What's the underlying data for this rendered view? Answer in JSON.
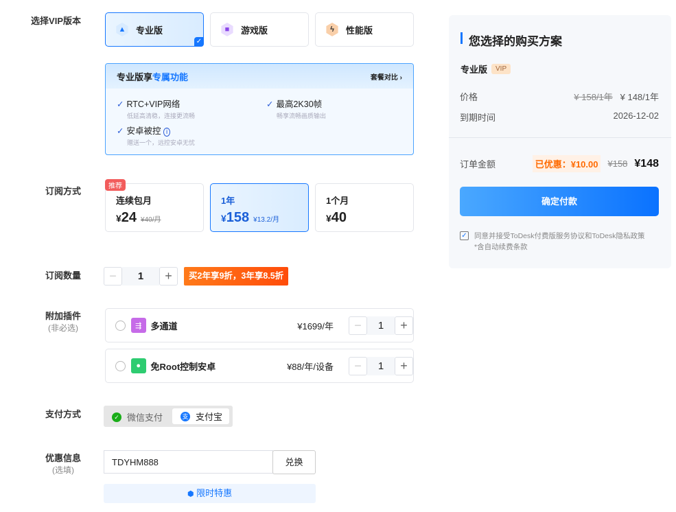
{
  "labels": {
    "version": "选择VIP版本",
    "subscription": "订阅方式",
    "quantity": "订阅数量",
    "addons": "附加插件",
    "addons_sub": "(非必选)",
    "payment": "支付方式",
    "coupon": "优惠信息",
    "coupon_sub": "(选填)"
  },
  "versions": [
    {
      "name": "专业版",
      "icon": "rocket-icon",
      "selected": true
    },
    {
      "name": "游戏版",
      "icon": "gamepad-icon"
    },
    {
      "name": "性能版",
      "icon": "lightning-icon"
    }
  ],
  "features": {
    "title_prefix": "专业版享",
    "title_highlight": "专属功能",
    "compare": "套餐对比",
    "items": [
      {
        "title": "RTC+VIP网络",
        "desc": "低延高清稳，连接更流畅"
      },
      {
        "title": "最高2K30帧",
        "desc": "畅享流畅画质输出"
      },
      {
        "title": "安卓被控",
        "desc": "赠送一个，远控安卓无忧"
      }
    ]
  },
  "plans": [
    {
      "badge": "推荐",
      "name": "连续包月",
      "currency": "¥",
      "price": "24",
      "orig": "¥40/月"
    },
    {
      "name": "1年",
      "currency": "¥",
      "price": "158",
      "orig": "¥13.2/月",
      "selected": true
    },
    {
      "name": "1个月",
      "currency": "¥",
      "price": "40"
    }
  ],
  "quantity": {
    "value": "1",
    "promo": "买2年享9折，3年享8.5折"
  },
  "addons": [
    {
      "name": "多通道",
      "price": "¥1699/年",
      "qty": "1",
      "color": "#c66be8"
    },
    {
      "name": "免Root控制安卓",
      "price": "¥88/年/设备",
      "qty": "1",
      "color": "#2ecc71"
    }
  ],
  "payment": {
    "wechat": "微信支付",
    "alipay": "支付宝",
    "selected": "alipay"
  },
  "coupon": {
    "value": "TDYHM888",
    "redeem": "兑换",
    "limited": "限时特惠"
  },
  "summary": {
    "title": "您选择的购买方案",
    "plan": "专业版",
    "badge": "VIP",
    "price_label": "价格",
    "price_orig": "¥ 158/1年",
    "price_now": "¥ 148/1年",
    "expire_label": "到期时间",
    "expire": "2026-12-02",
    "total_label": "订单金额",
    "discount": "已优惠：¥10.00",
    "total_orig": "¥158",
    "total": "¥148",
    "pay": "确定付款",
    "agree": "同意并接受ToDesk付费版服务协议和ToDesk隐私政策",
    "agree_note": "*含自动续费条款",
    "agreed": true
  },
  "colors": {
    "accent": "#1677ff",
    "orange": "#ff6a00"
  }
}
